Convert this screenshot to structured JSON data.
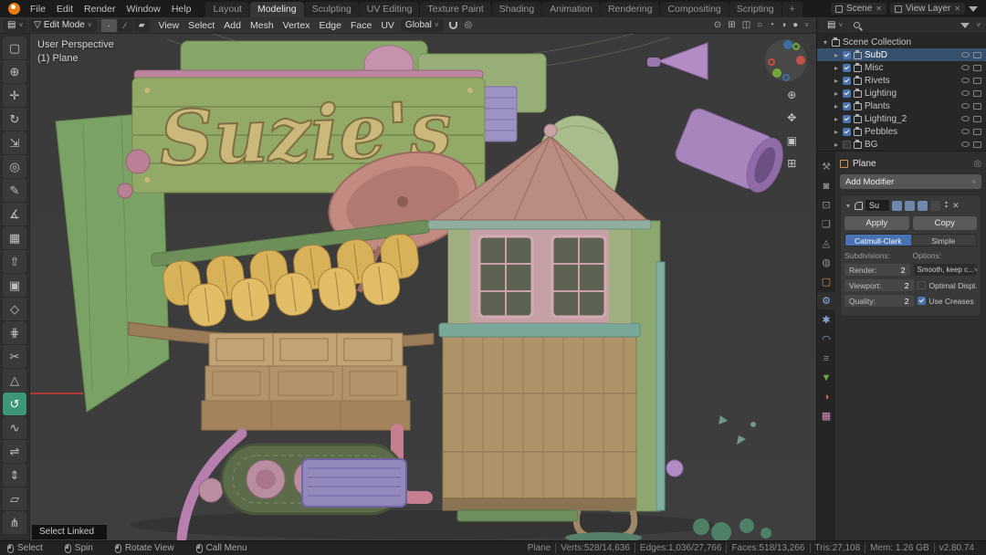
{
  "topbar": {
    "menus": [
      {
        "label": "File",
        "name": "menu-file"
      },
      {
        "label": "Edit",
        "name": "menu-edit"
      },
      {
        "label": "Render",
        "name": "menu-render"
      },
      {
        "label": "Window",
        "name": "menu-window"
      },
      {
        "label": "Help",
        "name": "menu-help"
      }
    ],
    "tabs": [
      {
        "label": "Layout"
      },
      {
        "label": "Modeling",
        "active": true
      },
      {
        "label": "Sculpting"
      },
      {
        "label": "UV Editing"
      },
      {
        "label": "Texture Paint"
      },
      {
        "label": "Shading"
      },
      {
        "label": "Animation"
      },
      {
        "label": "Rendering"
      },
      {
        "label": "Compositing"
      },
      {
        "label": "Scripting"
      },
      {
        "label": "+",
        "name": "add-workspace-tab"
      }
    ],
    "scene_label": "Scene",
    "view_layer_label": "View Layer"
  },
  "viewport_header": {
    "mode_label": "Edit Mode",
    "menus": [
      {
        "label": "View",
        "name": "viewport-menu-view"
      },
      {
        "label": "Select",
        "name": "viewport-menu-select"
      },
      {
        "label": "Add",
        "name": "viewport-menu-add"
      },
      {
        "label": "Mesh",
        "name": "viewport-menu-mesh"
      },
      {
        "label": "Vertex",
        "name": "viewport-menu-vertex"
      },
      {
        "label": "Edge",
        "name": "viewport-menu-edge"
      },
      {
        "label": "Face",
        "name": "viewport-menu-face"
      },
      {
        "label": "UV",
        "name": "viewport-menu-uv"
      }
    ],
    "orientation_label": "Global"
  },
  "toolbar": {
    "tools": [
      {
        "name": "select-box-tool",
        "glyph": "▢"
      },
      {
        "name": "cursor-tool",
        "glyph": "⊕"
      },
      {
        "name": "move-tool",
        "glyph": "✛"
      },
      {
        "name": "rotate-tool",
        "glyph": "↻"
      },
      {
        "name": "scale-tool",
        "glyph": "⇲"
      },
      {
        "name": "transform-tool",
        "glyph": "◎"
      },
      {
        "name": "annotate-tool",
        "glyph": "✎"
      },
      {
        "name": "measure-tool",
        "glyph": "∡"
      },
      {
        "name": "add-cube-tool",
        "glyph": "▦"
      },
      {
        "name": "extrude-region-tool",
        "glyph": "⇧"
      },
      {
        "name": "inset-faces-tool",
        "glyph": "▣"
      },
      {
        "name": "bevel-tool",
        "glyph": "◇"
      },
      {
        "name": "loop-cut-tool",
        "glyph": "⋕"
      },
      {
        "name": "knife-tool",
        "glyph": "✂"
      },
      {
        "name": "poly-build-tool",
        "glyph": "△"
      },
      {
        "name": "spin-tool",
        "glyph": "↺",
        "active": true
      },
      {
        "name": "smooth-tool",
        "glyph": "∿"
      },
      {
        "name": "edge-slide-tool",
        "glyph": "⇌"
      },
      {
        "name": "shrink-fatten-tool",
        "glyph": "⇕"
      },
      {
        "name": "shear-tool",
        "glyph": "▱"
      },
      {
        "name": "rip-region-tool",
        "glyph": "⋔"
      }
    ]
  },
  "viewport": {
    "perspective_label": "User Perspective",
    "object_label": "(1) Plane",
    "sign_text": "Suzie's",
    "hint_label": "Select Linked"
  },
  "outliner": {
    "root_label": "Scene Collection",
    "items": [
      {
        "label": "SubD",
        "name": "outliner-row-subd",
        "selected": true,
        "checked": true
      },
      {
        "label": "Misc",
        "name": "outliner-row-misc",
        "checked": true
      },
      {
        "label": "Rivets",
        "name": "outliner-row-rivets",
        "checked": true
      },
      {
        "label": "Lighting",
        "name": "outliner-row-lighting",
        "checked": true
      },
      {
        "label": "Plants",
        "name": "outliner-row-plants",
        "checked": true
      },
      {
        "label": "Lighting_2",
        "name": "outliner-row-lighting-2",
        "checked": true
      },
      {
        "label": "Pebbles",
        "name": "outliner-row-pebbles",
        "checked": true
      },
      {
        "label": "BG",
        "name": "outliner-row-bg",
        "checked": false
      }
    ]
  },
  "properties": {
    "tabs": [
      {
        "name": "tool-tab",
        "glyph": "⚒"
      },
      {
        "name": "render-tab",
        "glyph": "◙"
      },
      {
        "name": "output-tab",
        "glyph": "⊡"
      },
      {
        "name": "view-layer-tab",
        "glyph": "❏"
      },
      {
        "name": "scene-tab",
        "glyph": "◬"
      },
      {
        "name": "world-tab",
        "glyph": "◍"
      },
      {
        "name": "object-tab",
        "glyph": "▢",
        "color": "#dd8d3f"
      },
      {
        "name": "modifiers-tab",
        "glyph": "⚙",
        "active": true,
        "color": "#86b3e2"
      },
      {
        "name": "particles-tab",
        "glyph": "✱",
        "color": "#8aa8cf"
      },
      {
        "name": "physics-tab",
        "glyph": "◠",
        "color": "#8aa8cf"
      },
      {
        "name": "constraints-tab",
        "glyph": "≡"
      },
      {
        "name": "object-data-tab",
        "glyph": "▼",
        "color": "#6fab4e"
      },
      {
        "name": "material-tab",
        "glyph": "◑",
        "color": "#cf6a5a"
      },
      {
        "name": "texture-tab",
        "glyph": "▦",
        "color": "#d98ac0"
      }
    ],
    "breadcrumb_object": "Plane",
    "add_modifier_label": "Add Modifier",
    "modifier": {
      "name": "Su",
      "apply_label": "Apply",
      "copy_label": "Copy",
      "algorithm_options": [
        "Catmull-Clark",
        "Simple"
      ],
      "active_algorithm": "Catmull-Clark",
      "subdivisions_label": "Subdivisions:",
      "options_label": "Options:",
      "fields": [
        {
          "label": "Render:",
          "value": "2"
        },
        {
          "label": "Viewport:",
          "value": "2"
        },
        {
          "label": "Quality:",
          "value": "2"
        }
      ],
      "uv_smooth_value": "Smooth, keep c...",
      "optimal_display_label": "Optimal Displ.",
      "optimal_display_checked": false,
      "use_creases_label": "Use Creases",
      "use_creases_checked": true
    }
  },
  "statusbar": {
    "hints": [
      {
        "label": "Select",
        "name": "hint-select"
      },
      {
        "label": "Spin",
        "name": "hint-spin"
      },
      {
        "label": "Rotate View",
        "name": "hint-rotate-view"
      },
      {
        "label": "Call Menu",
        "name": "hint-call-menu"
      }
    ],
    "stats": [
      "Plane",
      "Verts:528/14,636",
      "Edges:1,036/27,766",
      "Faces:518/13,266",
      "Tris:27,108",
      "Mem: 1.26 GB",
      "v2.80.74"
    ]
  },
  "icons": {
    "dropdown_arrow": "˅",
    "caret_down": "▾",
    "caret_right": "▸",
    "close": "✕",
    "pin": "◎",
    "editor_type": "▤",
    "mode_icon": "▽",
    "vertex_mode": "∙",
    "edge_mode": "∕",
    "face_mode": "▰",
    "proportional": "◎",
    "visibility": "⊙",
    "xray": "◫",
    "overlays": "⊞",
    "shading_wire": "○",
    "shading_solid": "◔",
    "shading_material": "◑",
    "shading_rendered": "●",
    "zoom": "⊕",
    "pan": "✥",
    "camera": "▣",
    "ortho": "⊞",
    "up": "▴",
    "down": "▾"
  }
}
